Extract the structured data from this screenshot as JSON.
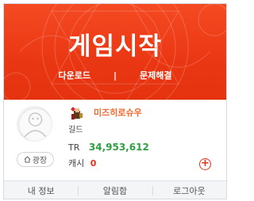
{
  "banner": {
    "title": "게임시작",
    "download_label": "다운로드",
    "separator": "|",
    "troubleshoot_label": "문제해결"
  },
  "profile": {
    "character_name": "미즈히로슈우",
    "guild_label": "길드",
    "tr_label": "TR",
    "tr_value": "34,953,612",
    "cash_label": "캐시",
    "cash_value": "0",
    "plaza_label": "광장",
    "plus_label": "+"
  },
  "menu": {
    "items": [
      "내 정보",
      "알림함",
      "로그아웃"
    ]
  },
  "colors": {
    "banner": "#ea3713",
    "character_name": "#f06a30",
    "tr_value": "#2f9e44",
    "cash_value": "#e4321b"
  }
}
